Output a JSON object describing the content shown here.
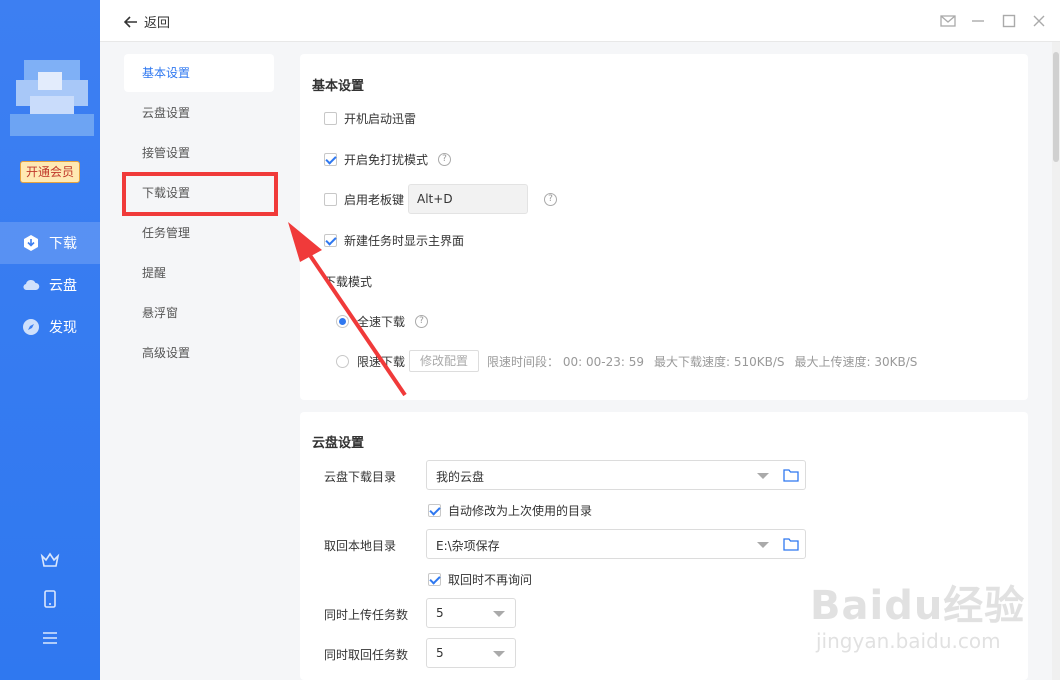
{
  "topbar": {
    "back_label": "返回"
  },
  "sidebar": {
    "vip_label": "开通会员",
    "nav": [
      {
        "label": "下载",
        "icon": "download-icon",
        "active": true
      },
      {
        "label": "云盘",
        "icon": "cloud-icon",
        "active": false
      },
      {
        "label": "发现",
        "icon": "compass-icon",
        "active": false
      }
    ],
    "bottom_icons": [
      "crown-icon",
      "phone-icon",
      "menu-icon"
    ]
  },
  "submenu": {
    "items": [
      "基本设置",
      "云盘设置",
      "接管设置",
      "下载设置",
      "任务管理",
      "提醒",
      "悬浮窗",
      "高级设置"
    ],
    "active_index": 0
  },
  "basic": {
    "title": "基本设置",
    "autostart": {
      "label": "开机启动迅雷",
      "checked": false
    },
    "nodisturb": {
      "label": "开启免打扰模式",
      "checked": true
    },
    "bosskey": {
      "label": "启用老板键",
      "checked": false,
      "value": "Alt+D"
    },
    "showmain": {
      "label": "新建任务时显示主界面",
      "checked": true
    },
    "mode_label": "下载模式",
    "full_speed": {
      "label": "全速下载",
      "selected": true
    },
    "limit_speed": {
      "label": "限速下载",
      "button": "修改配置",
      "period": "限速时间段：  00: 00-23: 59",
      "max_down": "最大下载速度: 510KB/S",
      "max_up": "最大上传速度: 30KB/S"
    }
  },
  "cloud": {
    "title": "云盘设置",
    "download_dir_label": "云盘下载目录",
    "download_dir_value": "我的云盘",
    "auto_modify": {
      "label": "自动修改为上次使用的目录",
      "checked": true
    },
    "local_dir_label": "取回本地目录",
    "local_dir_value": "E:\\杂项保存",
    "no_ask": {
      "label": "取回时不再询问",
      "checked": true
    },
    "upload_label": "同时上传任务数",
    "upload_value": "5",
    "fetch_label": "同时取回任务数",
    "fetch_value": "5"
  },
  "watermark": {
    "line1": "Baidu经验",
    "line2": "jingyan.baidu.com"
  },
  "colors": {
    "accent": "#2f78f0",
    "highlight": "#f03a3a",
    "sidebar": "#3d7ff2"
  }
}
